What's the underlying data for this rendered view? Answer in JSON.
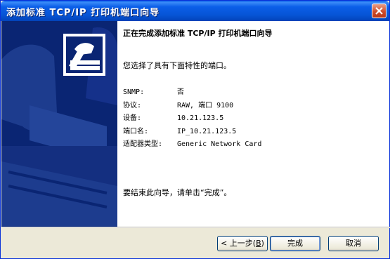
{
  "window": {
    "title": "添加标准 TCP/IP 打印机端口向导"
  },
  "content": {
    "heading": "正在完成添加标准 TCP/IP 打印机端口向导",
    "intro": "您选择了具有下面特性的端口。",
    "properties": [
      {
        "label": "SNMP:",
        "value": "否"
      },
      {
        "label": "协议:",
        "value": "RAW, 端口 9100"
      },
      {
        "label": "设备:",
        "value": "10.21.123.5"
      },
      {
        "label": "端口名:",
        "value": "IP_10.21.123.5"
      },
      {
        "label": "适配器类型:",
        "value": "Generic Network Card"
      }
    ],
    "finish_hint": "要结束此向导，请单击“完成”。"
  },
  "buttons": {
    "back_prefix": "< 上一步(",
    "back_key": "B",
    "back_suffix": ")",
    "finish": "完成",
    "cancel": "取消"
  },
  "icons": {
    "close": "close-icon",
    "wizard": "printer-wizard-icon"
  },
  "colors": {
    "titlebar": "#0654d6",
    "sidebar": "#0a2573",
    "dialog_bg": "#ece9d8"
  }
}
